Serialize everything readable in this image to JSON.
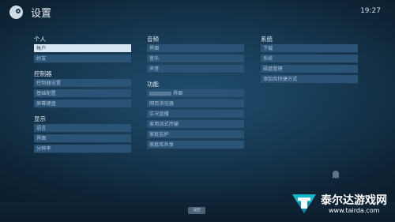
{
  "header": {
    "title": "设置",
    "time": "19:27"
  },
  "columns": [
    {
      "groups": [
        {
          "title": "个人",
          "items": [
            {
              "label": "帐户",
              "active": true
            },
            {
              "label": "好友"
            }
          ]
        },
        {
          "title": "控制器",
          "items": [
            {
              "label": "控制器设置"
            },
            {
              "label": "基础配置"
            },
            {
              "label": "屏幕键盘"
            }
          ]
        },
        {
          "title": "显示",
          "items": [
            {
              "label": "语言"
            },
            {
              "label": "界面"
            },
            {
              "label": "分辨率"
            }
          ]
        }
      ]
    },
    {
      "groups": [
        {
          "title": "音频",
          "items": [
            {
              "label": "界面"
            },
            {
              "label": "音乐"
            },
            {
              "label": "声音"
            }
          ]
        },
        {
          "title": "功能",
          "items": [
            {
              "label": "界面",
              "blurred_prefix": true
            },
            {
              "label": "网页浏览器"
            },
            {
              "label": "实况直播"
            },
            {
              "label": "家用流式传输"
            },
            {
              "label": "家庭监护"
            },
            {
              "label": "家庭库共享"
            }
          ]
        }
      ]
    },
    {
      "groups": [
        {
          "title": "系统",
          "items": [
            {
              "label": "下载"
            },
            {
              "label": "系统"
            },
            {
              "label": "磁盘管理"
            },
            {
              "label": "添加库快捷方式"
            }
          ]
        }
      ]
    }
  ],
  "footer": {
    "back_label": "返回"
  },
  "watermark": {
    "name": "泰尔达游戏网",
    "url": "www.tairda.com",
    "icon": "tairda-logo-icon"
  },
  "icons": {
    "app": "steam-logo-icon",
    "decorative": "ghost-icon"
  },
  "colors": {
    "item_bg": "#2a5376",
    "item_active_bg": "#d8e7f2"
  }
}
